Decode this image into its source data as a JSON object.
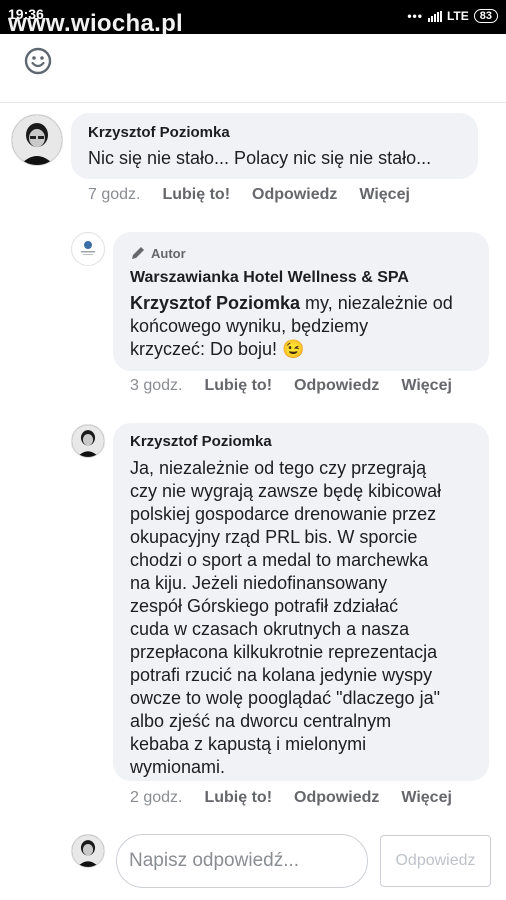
{
  "status_bar": {
    "time": "19:36",
    "network": "LTE",
    "battery": "83"
  },
  "watermark": "www.wiocha.pl",
  "comments": [
    {
      "author": "Krzysztof Poziomka",
      "text": "Nic się nie stało... Polacy nic się nie stało...",
      "time": "7 godz.",
      "like": "Lubię to!",
      "reply": "Odpowiedz",
      "more": "Więcej"
    },
    {
      "badge": "Autor",
      "author": "Warszawianka Hotel Wellness & SPA",
      "mention": "Krzysztof Poziomka",
      "text_line1": " my, niezależnie od",
      "text_line2": "końcowego wyniku, będziemy",
      "text_line3": "krzyczeć: Do boju!",
      "emoji": "😉",
      "time": "3 godz.",
      "like": "Lubię to!",
      "reply": "Odpowiedz",
      "more": "Więcej"
    },
    {
      "author": "Krzysztof Poziomka",
      "lines": [
        "Ja, niezależnie od tego czy przegrają",
        "czy nie wygrają zawsze będę kibicował",
        "polskiej gospodarce drenowanie przez",
        "okupacyjny rząd PRL bis. W sporcie",
        "chodzi o sport a medal to marchewka",
        "na kiju. Jeżeli niedofinansowany",
        "zespół Górskiego potrafił zdziałać",
        "cuda w czasach okrutnych a nasza",
        "przepłacona kilkukrotnie reprezentacja",
        "potrafi rzucić na kolana jedynie wyspy",
        "owcze to wolę pooglądać \"dlaczego ja\"",
        "albo zjeść na dworcu centralnym",
        "kebaba z kapustą i mielonymi",
        "wymionami."
      ],
      "time": "2 godz.",
      "like": "Lubię to!",
      "reply": "Odpowiedz",
      "more": "Więcej"
    }
  ],
  "reply_box": {
    "placeholder": "Napisz odpowiedź...",
    "button": "Odpowiedz"
  },
  "icons": {
    "emoji_picker": "smiley-icon",
    "author_badge": "pencil-icon"
  }
}
